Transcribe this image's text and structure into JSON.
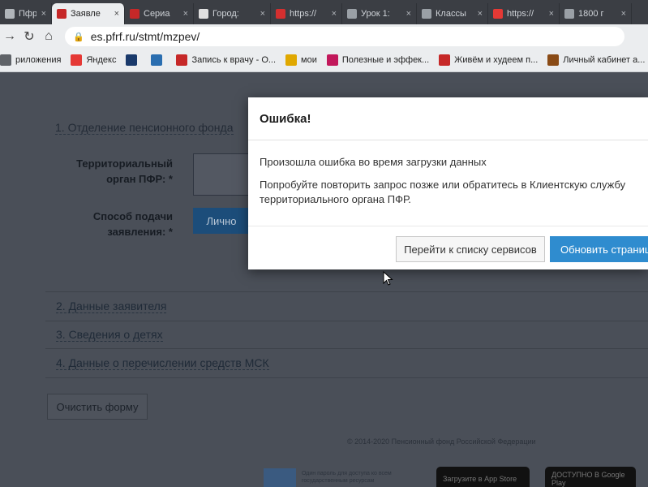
{
  "browser": {
    "tabs": [
      {
        "label": "Пфр ос",
        "active": false,
        "color": "#b0b5ba"
      },
      {
        "label": "Заявле",
        "active": true,
        "color": "#c62828"
      },
      {
        "label": "Сериа",
        "active": false,
        "color": "#c62828"
      },
      {
        "label": "Город:",
        "active": false,
        "color": "#e0e0e0"
      },
      {
        "label": "https://",
        "active": false,
        "color": "#d32f2f"
      },
      {
        "label": "Урок 1:",
        "active": false,
        "color": "#9aa0a6"
      },
      {
        "label": "Классы",
        "active": false,
        "color": "#9aa0a6"
      },
      {
        "label": "https://",
        "active": false,
        "color": "#e53935"
      },
      {
        "label": "1800 г",
        "active": false,
        "color": "#9aa0a6"
      }
    ],
    "close_glyph": "×",
    "url": "es.pfrf.ru/stmt/mzpev/",
    "bookmarks": [
      {
        "label": "риложения",
        "icon": "apps-icon",
        "color": "#5f6368"
      },
      {
        "label": "Яндекс",
        "icon": "yandex-icon",
        "color": "#e53935"
      },
      {
        "label": "",
        "icon": "bookmark-icon-1",
        "color": "#1a3a6b"
      },
      {
        "label": "",
        "icon": "bookmark-icon-2",
        "color": "#2a6eb0"
      },
      {
        "label": "Запись к врачу - О...",
        "icon": "medical-cross-icon",
        "color": "#c62828"
      },
      {
        "label": "мои",
        "icon": "folder-icon",
        "color": "#e0a800"
      },
      {
        "label": "Полезные и эффек...",
        "icon": "health-icon",
        "color": "#c2185b"
      },
      {
        "label": "Живём и худеем п...",
        "icon": "seven-icon",
        "color": "#c62828"
      },
      {
        "label": "Личный кабинет а...",
        "icon": "coin-icon",
        "color": "#8a4b16"
      }
    ]
  },
  "page": {
    "section1_title": "1. Отделение пенсионного фонда",
    "territorial_label": "Территориальный орган ПФР: *",
    "method_label": "Способ подачи заявления: *",
    "method_value": "Лично",
    "section2_title": "2. Данные заявителя",
    "section3_title": "3. Сведения о детях",
    "section4_title": "4. Данные о перечислении средств МСК",
    "clear_form": "Очистить форму",
    "footer": "© 2014-2020 Пенсионный фонд Российской Федерации",
    "gos_text": "Один пароль для доступа ко всем государственным ресурсам",
    "app_store": "Загрузите в App Store",
    "google_play": "ДОСТУПНО В Google Play"
  },
  "modal": {
    "title": "Ошибка!",
    "message1": "Произошла ошибка во время загрузки данных",
    "message2": "Попробуйте повторить запрос позже или обратитесь в Клиентскую службу территориального органа ПФР.",
    "secondary_button": "Перейти к списку сервисов",
    "primary_button": "Обновить страницу"
  },
  "colors": {
    "primary": "#2f8ccf",
    "overlay_page": "#4a4f58"
  }
}
